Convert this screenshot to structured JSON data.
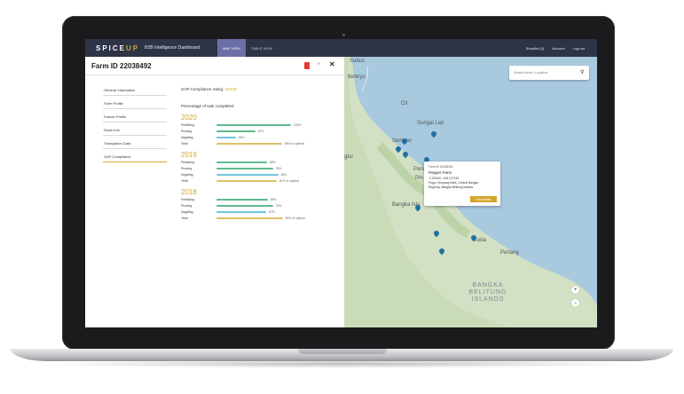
{
  "nav": {
    "logo_main": "SPICE",
    "logo_up": "UP",
    "subtitle": "B2B Intelligence Dashboard",
    "tabs": [
      {
        "label": "MAP VIEW",
        "active": true
      },
      {
        "label": "TABLE VIEW",
        "active": false
      }
    ],
    "shortlist": "Shortlist (5)",
    "account": "Account",
    "logout": "Log out"
  },
  "panel": {
    "title": "Farm ID 22038492",
    "menu": [
      {
        "label": "General Information"
      },
      {
        "label": "Farm Profile"
      },
      {
        "label": "Farmer Profile"
      },
      {
        "label": "Stock Info"
      },
      {
        "label": "Transaction Data"
      },
      {
        "label": "GAP Compliance",
        "active": true
      }
    ],
    "gap_label": "GAP Compliance rating:",
    "gap_rating": "GOOD",
    "pct_title": "Percentage of task completed",
    "years": [
      {
        "year": "2020",
        "bars": [
          {
            "label": "Fertilizing",
            "value": 100,
            "text": "100%",
            "color": "#5fba8c"
          },
          {
            "label": "Pruning",
            "value": 52,
            "text": "52%",
            "color": "#5fba8c"
          },
          {
            "label": "Irrigating",
            "value": 26,
            "text": "26%",
            "color": "#6ec6df"
          },
          {
            "label": "Yield",
            "value": 88,
            "text": "88% of optimal",
            "color": "#dcc06a"
          }
        ]
      },
      {
        "year": "2019",
        "bars": [
          {
            "label": "Fertilizing",
            "value": 68,
            "text": "68%",
            "color": "#5fba8c"
          },
          {
            "label": "Pruning",
            "value": 76,
            "text": "76%",
            "color": "#5fba8c"
          },
          {
            "label": "Irrigating",
            "value": 83,
            "text": "83%",
            "color": "#6ec6df"
          },
          {
            "label": "Yield",
            "value": 81,
            "text": "81% of optimal",
            "color": "#dcc06a"
          }
        ]
      },
      {
        "year": "2018",
        "bars": [
          {
            "label": "Fertilizing",
            "value": 69,
            "text": "69%",
            "color": "#5fba8c"
          },
          {
            "label": "Pruning",
            "value": 76,
            "text": "76%",
            "color": "#5fba8c"
          },
          {
            "label": "Irrigating",
            "value": 67,
            "text": "67%",
            "color": "#6ec6df"
          },
          {
            "label": "Yield",
            "value": 89,
            "text": "89% of optimal",
            "color": "#dcc06a"
          }
        ]
      }
    ]
  },
  "map": {
    "search_placeholder": "Search Area / Location",
    "places": [
      "Subus",
      "Belinyu",
      "Cit",
      "Sungai Liat",
      "Sempan",
      "gku",
      "Panc",
      "Pin",
      "Bangka Isla",
      "Koba",
      "Perlang"
    ],
    "region": "BANGKA BELITUNG ISLANDS",
    "popup": {
      "id": "Farm ID 22038492",
      "name": "Pepper Farm",
      "coords": "-2.304401, 106.072726",
      "addr1": "Pugul, Simpang Katis, Central Bangka",
      "addr2": "Regency, Bangka Belitung Islands",
      "button": "View details"
    },
    "zoom_in": "+",
    "zoom_out": "−"
  }
}
